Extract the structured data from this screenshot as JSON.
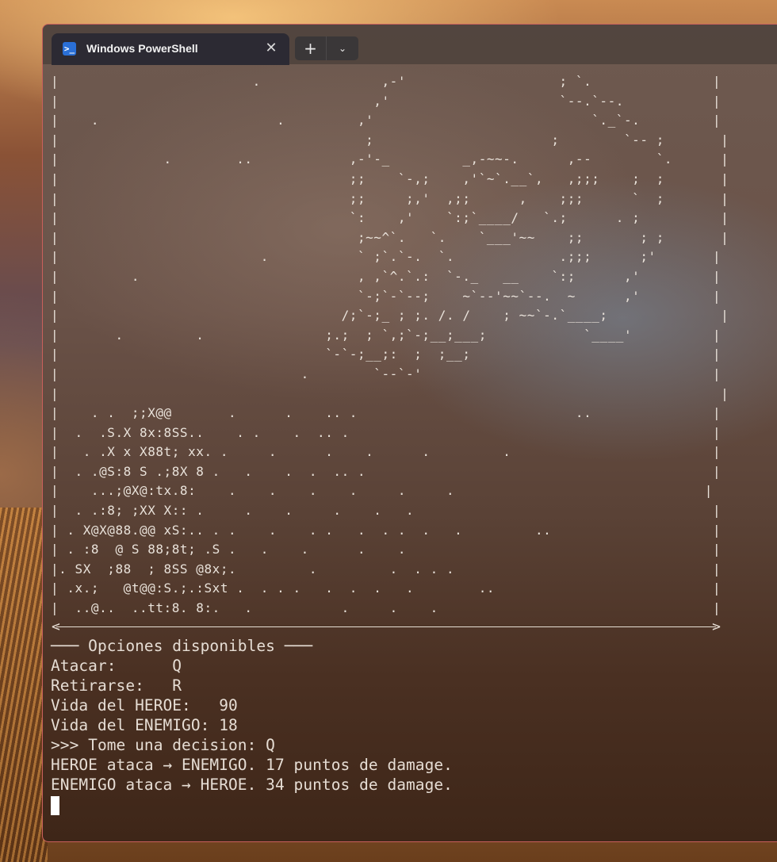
{
  "window": {
    "tab_title": "Windows PowerShell",
    "tab_icon": "powershell-icon",
    "close_icon": "close-icon",
    "new_tab_icon": "plus-icon",
    "dropdown_icon": "chevron-down-icon",
    "accent": "#c9605c"
  },
  "terminal": {
    "ascii_art": "|                        .               ,-'                   ; `.               |\n|                                       ,'                     `--.`--.           |\n|    .                      .         ,'                           `._`-.         |\n|                                      ;                      ;        `-- ;       |\n|             .        ..            ,-'-_         _,-~~-.      ,--        `.      |\n|                                    ;;    `-,;    ,'`~`.__`,   ,;;;    ;  ;       |\n|                                    ;;     ;,'  ,;;      ,    ;;;      `  ;       |\n|                                    `:    ,'    `:;`____/   `.;      . ;          |\n|                                     ;~~^`.   `.    `___'~~    ;;       ; ;       |\n|                         .           ` ;`.`-.  `.             .;;;      ;'       |\n|         .                           , ,`^.`.:  `-._   __    `:;      ,'         |\n|                                     `-;`-`--;    ~`--'~~`--.  ~      ,'         |\n|                                   /;`-;_ ; ;. /. /    ; ~~`-.`____;              |\n|       .         .               ;.;  ; `,;`-;__;___;            `____'          |\n|                                 `-`-;__;:  ;  ;__;                              |\n|                              .        `--`-'                                    |\n|                                                                                  |\n|    . .  ;;X@@       .      .    .. .                           ..               |\n|  .  .S.X 8x:8SS..    . .    .  .. .                                             |\n|   . .X x X88t; xx. .     .      .    .      .         .                         |\n|  . .@S:8 S .;8X 8 .   .    .  .  .. .                                           |\n|    ...;@X@:tx.8:    .    .    .    .     .     .                               |\n|  . .:8; ;XX X:: .     .    .     .    .   .                                     |\n| . X@X@88.@@ xS:.. . .    .    . .   .  . .  .   .         ..                    |\n| . :8  @ S 88;8t; .S .   .    .      .    .                                      |\n|. SX  ;88  ; 8SS @8x;.         .         .  . . .                                |\n| .x.;   @t@@:S.;.:Sxt .  . . .   .  .  .   .        ..                           |\n|  ..@..  ..tt:8. 8:.   .           .     .    .                                  |",
    "menu_header": "─── Opciones disponibles ───",
    "attack_label": "Atacar:      Q",
    "retreat_label": "Retirarse:   R",
    "hero_health": "Vida del HEROE:   90",
    "enemy_health": "Vida del ENEMIGO: 18",
    "prompt_line": ">>> Tome una decision: Q",
    "hero_attack_line": "HEROE ataca → ENEMIGO. 17 puntos de damage.",
    "enemy_attack_line": "ENEMIGO ataca → HEROE. 34 puntos de damage."
  }
}
